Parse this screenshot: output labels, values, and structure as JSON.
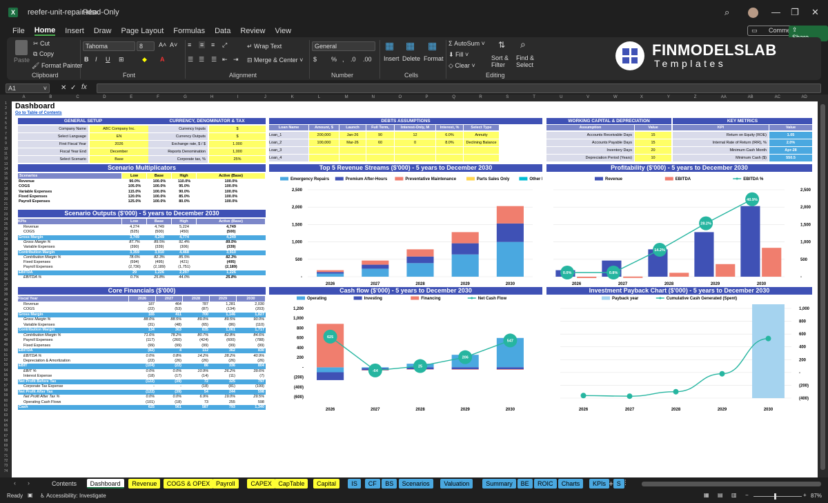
{
  "window": {
    "filename": "reefer-unit-repair.xlsx",
    "mode": "Read-Only"
  },
  "menu": [
    "File",
    "Home",
    "Insert",
    "Draw",
    "Page Layout",
    "Formulas",
    "Data",
    "Review",
    "View"
  ],
  "actions": {
    "comments": "Comments",
    "share": "Share"
  },
  "ribbon": {
    "paste": "Paste",
    "cut": "Cut",
    "copy": "Copy",
    "format_painter": "Format Painter",
    "clipboard": "Clipboard",
    "font_name": "Tahoma",
    "font_size": "8",
    "font": "Font",
    "wrap_text": "Wrap Text",
    "merge_center": "Merge & Center",
    "alignment": "Alignment",
    "number_format": "General",
    "number": "Number",
    "insert": "Insert",
    "delete": "Delete",
    "format": "Format",
    "cells": "Cells",
    "autosum": "AutoSum",
    "fill": "Fill",
    "clear": "Clear",
    "sort_filter": "Sort & Filter",
    "find_select": "Find & Select",
    "editing": "Editing"
  },
  "logo": {
    "line1": "FINMODELSLAB",
    "line2": "Templates"
  },
  "formula_bar": {
    "cell": "A1",
    "fx": "fx"
  },
  "columns": [
    "A",
    "B",
    "C",
    "D",
    "E",
    "F",
    "G",
    "H",
    "I",
    "J",
    "K",
    "L",
    "M",
    "N",
    "O",
    "P",
    "Q",
    "R",
    "S",
    "T",
    "U",
    "V",
    "W",
    "X",
    "Y",
    "Z",
    "AA",
    "AB",
    "AC",
    "AD"
  ],
  "sheet": {
    "title": "Dashboard",
    "toc": "Go to Table of Contents",
    "general_setup": {
      "title": "GENERAL SETUP",
      "rows": [
        [
          "Company Name",
          "ABC Company Inc."
        ],
        [
          "Select Language",
          "EN"
        ],
        [
          "First Fiscal Year",
          "2026"
        ],
        [
          "Fiscal Year End",
          "December"
        ],
        [
          "Select Scenario",
          "Base"
        ]
      ]
    },
    "currency": {
      "title": "CURRENCY, DENOMINATOR & TAX",
      "rows": [
        [
          "Currency Inputs",
          "$"
        ],
        [
          "Currency Outputs",
          "$"
        ],
        [
          "Exchange rate, $ / $",
          "1.000"
        ],
        [
          "Reports Denomination",
          "1,000"
        ],
        [
          "Corporate tax, %",
          "25%"
        ]
      ]
    },
    "debts": {
      "title": "DEBTS ASSUMPTIONS",
      "headers": [
        "Loan Name",
        "Amount, $",
        "Launch",
        "Full Term, Months",
        "Interest-Only, M",
        "Interest, %",
        "Select Type"
      ],
      "rows": [
        [
          "Loan_1",
          "200,000",
          "Jan-26",
          "90",
          "12",
          "6.0%",
          "Annuity"
        ],
        [
          "Loan_2",
          "100,000",
          "Mar-26",
          "60",
          "0",
          "8.0%",
          "Declining Balance"
        ],
        [
          "Loan_3",
          "",
          "",
          "",
          "",
          "",
          ""
        ],
        [
          "Loan_4",
          "",
          "",
          "",
          "",
          "",
          ""
        ]
      ]
    },
    "wc": {
      "title": "WORKING CAPITAL & DEPRECIATION",
      "headers": [
        "Assumption",
        "Value"
      ],
      "rows": [
        [
          "Accounts Receivable Days",
          "15"
        ],
        [
          "Accounts Payable Days",
          "15"
        ],
        [
          "Inventory Days",
          "20"
        ],
        [
          "Depreciation Period (Years)",
          "10"
        ]
      ]
    },
    "kpi": {
      "title": "KEY METRICS",
      "headers": [
        "KPI",
        "Value"
      ],
      "rows": [
        [
          "Return on Equity (ROE)",
          "1.05"
        ],
        [
          "Internal Rate of Return (IRR), %",
          "2.0%"
        ],
        [
          "Minimum Cash Month",
          "Apr-28"
        ],
        [
          "Minimum Cash ($)",
          "550.5"
        ]
      ]
    },
    "multipliers": {
      "title": "Scenario Multiplicators",
      "headers": [
        "Scenarios",
        "Low",
        "Base",
        "High",
        "Active (Base)"
      ],
      "rows": [
        [
          "Revenue",
          "90.0%",
          "100.0%",
          "110.0%",
          "100.0%"
        ],
        [
          "COGS",
          "105.0%",
          "100.0%",
          "95.0%",
          "100.0%"
        ],
        [
          "Variable Expenses",
          "115.0%",
          "100.0%",
          "90.0%",
          "100.0%"
        ],
        [
          "Fixed Expenses",
          "120.0%",
          "100.0%",
          "85.0%",
          "100.0%"
        ],
        [
          "Payroll Expenses",
          "125.0%",
          "100.0%",
          "80.0%",
          "100.0%"
        ]
      ]
    },
    "outputs": {
      "title": "Scenario Outputs ($'000) - 5 years to December 2030",
      "headers": [
        "KPIs",
        "Low",
        "Base",
        "High",
        "Active (Base)"
      ],
      "rows": [
        [
          "Revenue",
          "4,274",
          "4,749",
          "5,224",
          "4,749",
          "n"
        ],
        [
          "COGS",
          "(525)",
          "(500)",
          "(450)",
          "(500)",
          "n"
        ],
        [
          "Gross Margin",
          "3,749",
          "4,249",
          "4,774",
          "4,249",
          "h"
        ],
        [
          "Gross Margin %",
          "87.7%",
          "89.5%",
          "91.4%",
          "89.5%",
          "i"
        ],
        [
          "Variable Expenses",
          "(390)",
          "(339)",
          "(306)",
          "(339)",
          "n"
        ],
        [
          "Contribution Margin",
          "3,359",
          "3,910",
          "4,468",
          "3,910",
          "h"
        ],
        [
          "Contribution Margin %",
          "78.6%",
          "82.3%",
          "85.5%",
          "82.3%",
          "i"
        ],
        [
          "Fixed Expenses",
          "(594)",
          "(495)",
          "(421)",
          "(495)",
          "n"
        ],
        [
          "Payroll Expenses",
          "(2,736)",
          "(2,189)",
          "(1,751)",
          "(2,189)",
          "n"
        ],
        [
          "EBITDA",
          "29",
          "1,226",
          "2,297",
          "1,226",
          "h"
        ],
        [
          "EBITDA %",
          "0.7%",
          "25.8%",
          "44.0%",
          "25.8%",
          "i"
        ]
      ]
    },
    "core": {
      "title": "Core Financials ($'000)",
      "headers": [
        "Fiscal Year",
        "2026",
        "2027",
        "2028",
        "2029",
        "2030"
      ],
      "rows": [
        [
          "Revenue",
          "187",
          "464",
          "787",
          "1,281",
          "2,030",
          "n"
        ],
        [
          "COGS",
          "(22)",
          "(53)",
          "(87)",
          "(134)",
          "(203)",
          "n"
        ],
        [
          "Gross Margin",
          "165",
          "411",
          "700",
          "1,146",
          "1,827",
          "h"
        ],
        [
          "Gross Margin %",
          "88.0%",
          "88.5%",
          "89.0%",
          "89.5%",
          "90.0%",
          "i"
        ],
        [
          "Variable Expenses",
          "(31)",
          "(48)",
          "(65)",
          "(86)",
          "(110)",
          "n"
        ],
        [
          "Contribution Margin",
          "134",
          "363",
          "635",
          "1,061",
          "1,717",
          "h"
        ],
        [
          "Contribution Margin %",
          "71.6%",
          "78.2%",
          "80.7%",
          "82.8%",
          "84.6%",
          "i"
        ],
        [
          "Payroll Expenses",
          "(117)",
          "(260)",
          "(424)",
          "(600)",
          "(788)",
          "n"
        ],
        [
          "Fixed Expenses",
          "(99)",
          "(99)",
          "(99)",
          "(99)",
          "(99)",
          "n"
        ],
        [
          "EBITDA",
          "(82)",
          "4",
          "112",
          "362",
          "830",
          "h"
        ],
        [
          "EBITDA %",
          "0.0%",
          "0.8%",
          "14.2%",
          "28.2%",
          "40.9%",
          "i"
        ],
        [
          "Depreciation & Amortization",
          "(22)",
          "(26)",
          "(26)",
          "(26)",
          "(26)",
          "n"
        ],
        [
          "EBIT",
          "(104)",
          "(22)",
          "86",
          "336",
          "804",
          "h"
        ],
        [
          "EBIT %",
          "0.0%",
          "0.0%",
          "10.9%",
          "26.2%",
          "39.6%",
          "i"
        ],
        [
          "Interest Expense",
          "(18)",
          "(17)",
          "(14)",
          "(11)",
          "(7)",
          "n"
        ],
        [
          "Net Profit Before Tax",
          "(122)",
          "(39)",
          "72",
          "325",
          "797",
          "h"
        ],
        [
          "Corporate Tax Expense",
          "-",
          "-",
          "(18)",
          "(81)",
          "(199)",
          "n"
        ],
        [
          "Net Profit After Tax",
          "(122)",
          "(39)",
          "54",
          "244",
          "598",
          "h"
        ],
        [
          "Net Profit After Tax %",
          "0.0%",
          "0.0%",
          "6.9%",
          "19.0%",
          "29.5%",
          "i"
        ],
        [
          "Operating Cash Flows",
          "(101)",
          "(18)",
          "73",
          "255",
          "598",
          "n"
        ],
        [
          "Cash",
          "625",
          "561",
          "587",
          "793",
          "1,340",
          "h"
        ]
      ]
    }
  },
  "chart_data": [
    {
      "type": "bar",
      "title": "Top 5 Revenue Streams ($'000) - 5 years to December 2030",
      "categories": [
        "2026",
        "2027",
        "2028",
        "2029",
        "2030"
      ],
      "stacked": true,
      "ylim": [
        0,
        2500
      ],
      "yticks": [
        "-",
        "500",
        "1,000",
        "1,500",
        "2,000",
        "2,500"
      ],
      "series": [
        {
          "name": "Emergency Repairs",
          "color": "#4aa8e0",
          "values": [
            90,
            230,
            390,
            640,
            1000
          ]
        },
        {
          "name": "Premium After-Hours",
          "color": "#3f51b5",
          "values": [
            45,
            115,
            190,
            320,
            530
          ]
        },
        {
          "name": "Preventative Maintenance",
          "color": "#f07e6e",
          "values": [
            52,
            119,
            207,
            321,
            500
          ]
        },
        {
          "name": "Parts Sales Only",
          "color": "#ffd54f",
          "values": [
            0,
            0,
            0,
            0,
            0
          ]
        },
        {
          "name": "Other Revenue",
          "color": "#00bcd4",
          "values": [
            0,
            0,
            0,
            0,
            0
          ]
        }
      ]
    },
    {
      "type": "bar",
      "title": "Profitability ($'000) - 5 years to December 2030",
      "categories": [
        "2026",
        "2027",
        "2028",
        "2029",
        "2030"
      ],
      "ylim": [
        0,
        2500
      ],
      "yticks": [
        "-",
        "500",
        "1,000",
        "1,500",
        "2,000",
        "2,500"
      ],
      "series": [
        {
          "name": "Revenue",
          "color": "#3f51b5",
          "values": [
            187,
            464,
            787,
            1281,
            2030
          ]
        },
        {
          "name": "EBITDA",
          "color": "#f07e6e",
          "values": [
            -82,
            4,
            112,
            362,
            830
          ]
        }
      ],
      "line": {
        "name": "EBITDA %",
        "color": "#26b5a0",
        "values": [
          0.0,
          0.8,
          14.2,
          28.2,
          40.9
        ],
        "labels": [
          "0.0%",
          "0.8%",
          "14.2%",
          "28.2%",
          "40.9%"
        ],
        "ylim": [
          0,
          45
        ]
      }
    },
    {
      "type": "bar",
      "title": "Cash flow ($'000) - 5 years to December 2030",
      "categories": [
        "2026",
        "2027",
        "2028",
        "2029",
        "2030"
      ],
      "stacked": true,
      "ylim": [
        -600,
        1200
      ],
      "yticks": [
        "(600)",
        "(400)",
        "(200)",
        "-",
        "200",
        "400",
        "600",
        "800",
        "1,000",
        "1,200"
      ],
      "series": [
        {
          "name": "Operating",
          "color": "#4aa8e0",
          "values": [
            -101,
            -18,
            73,
            255,
            598
          ]
        },
        {
          "name": "Investing",
          "color": "#3f51b5",
          "values": [
            -160,
            -40,
            -40,
            -40,
            -40
          ]
        },
        {
          "name": "Financing",
          "color": "#f07e6e",
          "values": [
            886,
            -6,
            -7,
            -9,
            -11
          ]
        }
      ],
      "line": {
        "name": "Net Cash Flow",
        "color": "#26b5a0",
        "values": [
          625,
          -64,
          25,
          206,
          547
        ],
        "labels": [
          "625",
          "-64",
          "25",
          "206",
          "547"
        ]
      }
    },
    {
      "type": "area",
      "title": "Investment Payback Chart ($'000) - 5 years to December 2030",
      "categories": [
        "2026",
        "2027",
        "2028",
        "2029",
        "2030"
      ],
      "ylim": [
        -400,
        1000
      ],
      "yticks": [
        "(400)",
        "(200)",
        "-",
        "200",
        "400",
        "600",
        "800",
        "1,000"
      ],
      "series": [
        {
          "name": "Payback year",
          "color": "#a5d3ef",
          "values": [
            0,
            0,
            0,
            0,
            1
          ]
        },
        {
          "name": "Cumulative Cash Generated (Spent)",
          "color": "#26b5a0",
          "values": [
            -360,
            -370,
            -300,
            -20,
            530
          ]
        }
      ]
    }
  ],
  "tabs": [
    "Contents",
    "Dashboard",
    "Revenue",
    "COGS & OPEX",
    "Payroll",
    "CAPEX",
    "CapTable",
    "Capital",
    "IS",
    "CF",
    "BS",
    "Scenarios",
    "Valuation",
    "Summary",
    "BE",
    "ROIC",
    "Charts",
    "KPIs",
    "S"
  ],
  "status": {
    "ready": "Ready",
    "accessibility": "Accessibility: Investigate",
    "zoom": "87%"
  }
}
